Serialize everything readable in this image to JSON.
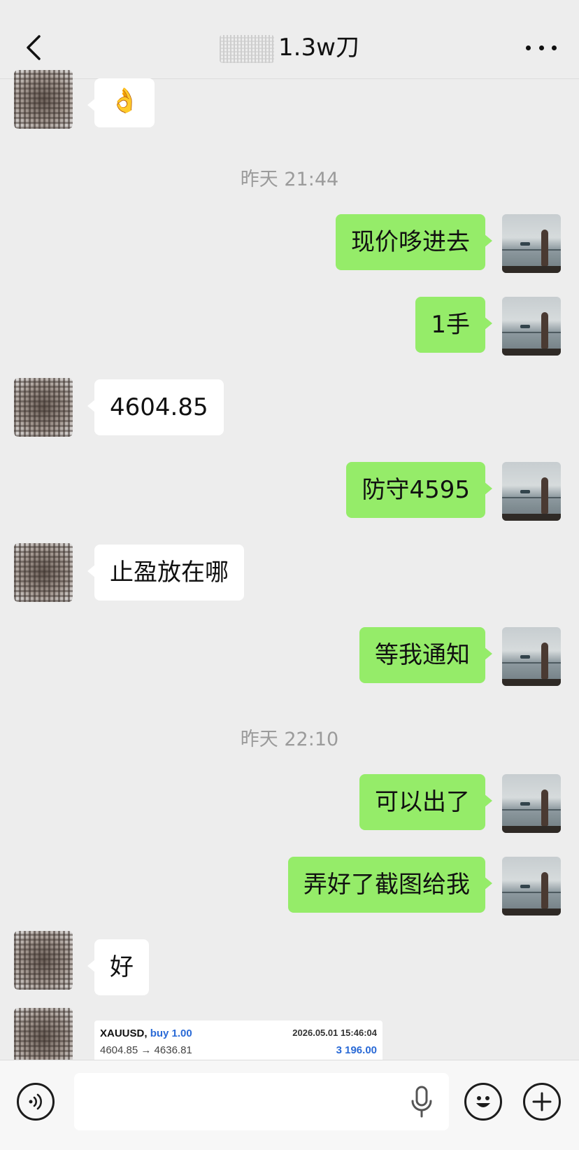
{
  "header": {
    "title": "1.3w刀"
  },
  "icons": {
    "back": "chevron-left-icon",
    "more": "more-dots-icon",
    "voice": "voice-icon",
    "mic": "mic-icon",
    "emoji": "emoji-icon",
    "add": "plus-icon"
  },
  "timestamps": [
    "昨天 21:44",
    "昨天 22:10"
  ],
  "messages": [
    {
      "from": "other",
      "text": "👌"
    },
    {
      "from": "self",
      "text": "现价哆进去"
    },
    {
      "from": "self",
      "text": "1手"
    },
    {
      "from": "other",
      "text": "4604.85"
    },
    {
      "from": "self",
      "text": "防守4595"
    },
    {
      "from": "other",
      "text": "止盈放在哪"
    },
    {
      "from": "self",
      "text": "等我通知"
    },
    {
      "from": "self",
      "text": "可以出了"
    },
    {
      "from": "self",
      "text": "弄好了截图给我"
    },
    {
      "from": "other",
      "text": "好"
    }
  ],
  "trade_card": {
    "symbol": "XAUUSD,",
    "direction": "buy 1.00",
    "datetime": "2026.05.01 15:46:04",
    "prices": "4604.85 → 4636.81",
    "profit": "3 196.00"
  },
  "colors": {
    "self_bubble": "#95ec69",
    "other_bubble": "#ffffff",
    "background": "#ededed",
    "profit": "#2a6ad6"
  }
}
